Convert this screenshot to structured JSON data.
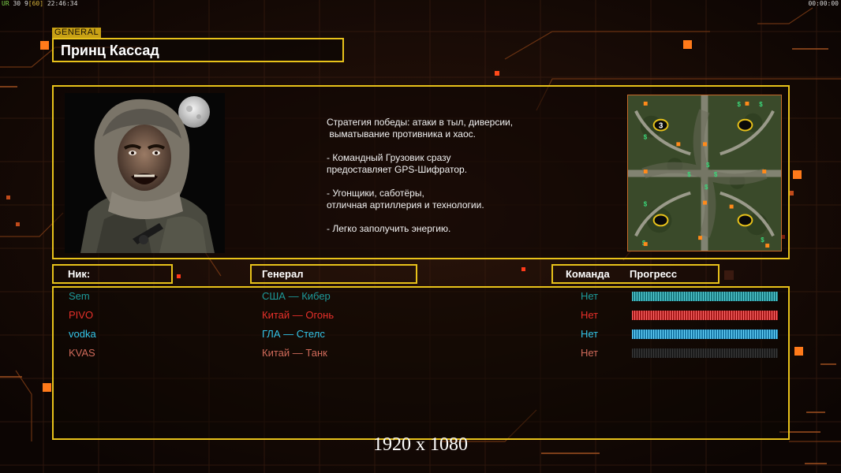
{
  "overlay": {
    "fps_prefix": "UR",
    "fps_a": "30",
    "fps_b": "9",
    "fps_c": "[60]",
    "time": "22:46:34",
    "timer": "00:00:00"
  },
  "general": {
    "tag": "GENERAL",
    "name": "Принц Кассад",
    "description": "Стратегия победы: атаки в тыл, диверсии,\n выматывание противника и хаос.\n\n- Командный Грузовик сразу\nпредоставляет GPS-Шифратор.\n\n- Угонщики, саботёры,\nотличная артиллерия и технологии.\n\n- Легко заполучить энергию."
  },
  "minimap": {
    "player_start_label": "3"
  },
  "headers": {
    "nick": "Ник:",
    "general": "Генерал",
    "team": "Команда",
    "progress": "Прогресс"
  },
  "players": [
    {
      "nick": "Sem",
      "general": "США — Кибер",
      "team": "Нет",
      "color": "#1d9a9a",
      "progress": 1.0,
      "bar": "cyan"
    },
    {
      "nick": "PIVO",
      "general": "Китай — Огонь",
      "team": "Нет",
      "color": "#e8302a",
      "progress": 1.0,
      "bar": "red"
    },
    {
      "nick": "vodka",
      "general": "ГЛА — Стелс",
      "team": "Нет",
      "color": "#33c4e8",
      "progress": 1.0,
      "bar": "blue"
    },
    {
      "nick": "KVAS",
      "general": "Китай — Танк",
      "team": "Нет",
      "color": "#d06a5a",
      "progress": 0.0,
      "bar": "empty"
    }
  ],
  "footer": {
    "resolution": "1920 x 1080"
  },
  "colors": {
    "frame_gold": "#e8c21a",
    "background": "#120906",
    "accent_orange": "#ff7a1a"
  }
}
